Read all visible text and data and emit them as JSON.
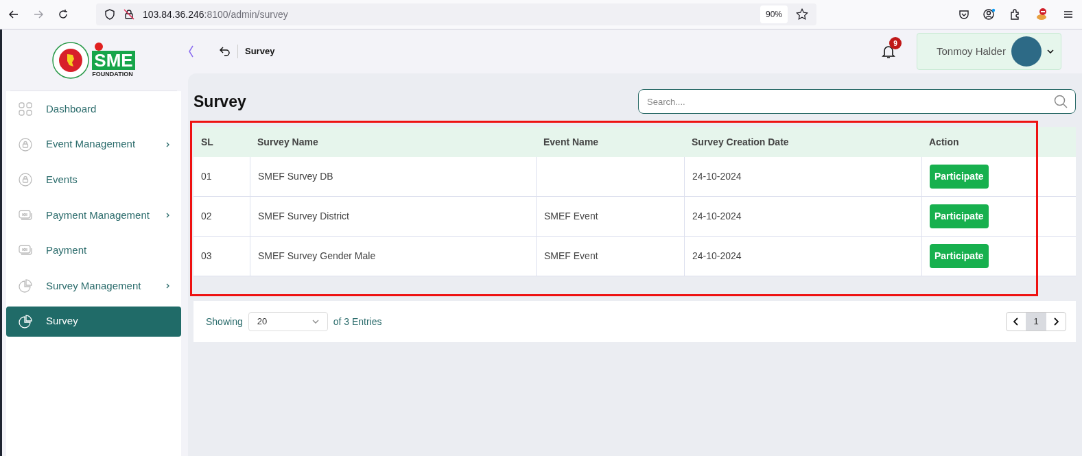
{
  "browser": {
    "url_host": "103.84.36.246",
    "url_path": ":8100/admin/survey",
    "zoom": "90%"
  },
  "logo": {
    "text": "SME",
    "subtitle": "FOUNDATION"
  },
  "sidebar": {
    "items": [
      {
        "label": "Dashboard",
        "kind": "grid",
        "has_submenu": false,
        "selected": false
      },
      {
        "label": "Event Management",
        "kind": "lock",
        "has_submenu": true,
        "selected": false
      },
      {
        "label": "Events",
        "kind": "lock",
        "has_submenu": false,
        "selected": false
      },
      {
        "label": "Payment Management",
        "kind": "money",
        "has_submenu": true,
        "selected": false
      },
      {
        "label": "Payment",
        "kind": "money",
        "has_submenu": false,
        "selected": false
      },
      {
        "label": "Survey Management",
        "kind": "pie",
        "has_submenu": true,
        "selected": false
      },
      {
        "label": "Survey",
        "kind": "pie",
        "has_submenu": false,
        "selected": true
      }
    ]
  },
  "header": {
    "breadcrumb": "Survey",
    "notifications": "9",
    "user": "Tonmoy Halder"
  },
  "page": {
    "title": "Survey",
    "search": {
      "placeholder": "Search...."
    }
  },
  "table": {
    "columns": [
      "SL",
      "Survey Name",
      "Event Name",
      "Survey Creation Date",
      "Action"
    ],
    "rows": [
      {
        "sl": "01",
        "name": "SMEF Survey DB",
        "event": "",
        "date": "24-10-2024",
        "action": "Participate"
      },
      {
        "sl": "02",
        "name": "SMEF Survey District",
        "event": "SMEF Event",
        "date": "24-10-2024",
        "action": "Participate"
      },
      {
        "sl": "03",
        "name": "SMEF Survey Gender Male",
        "event": "SMEF Event",
        "date": "24-10-2024",
        "action": "Participate"
      }
    ]
  },
  "pagination": {
    "showing": "Showing",
    "page_size": "20",
    "entries": "of 3 Entries",
    "pages": [
      {
        "label": "1",
        "selected": true
      }
    ]
  }
}
